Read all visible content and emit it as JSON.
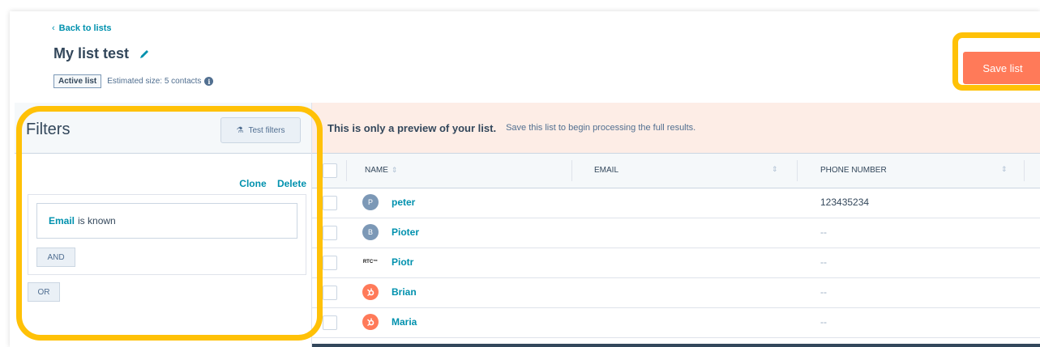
{
  "header": {
    "back_link": "Back to lists",
    "title": "My list test",
    "status_tag": "Active list",
    "estimated_size": "Estimated size: 5 contacts",
    "info_glyph": "i",
    "save_button": "Save list"
  },
  "filters": {
    "title": "Filters",
    "test_button": "Test filters",
    "clone": "Clone",
    "delete": "Delete",
    "filter_property": "Email",
    "filter_condition": "is known",
    "and_button": "AND",
    "or_button": "OR"
  },
  "preview": {
    "banner_bold": "This is only a preview of your list.",
    "banner_text": "Save this list to begin processing the full results.",
    "columns": {
      "name": "NAME",
      "email": "EMAIL",
      "phone": "PHONE NUMBER"
    },
    "rows": [
      {
        "avatar": "P",
        "avatar_type": "initial",
        "name": "peter",
        "phone": "123435234"
      },
      {
        "avatar": "B",
        "avatar_type": "initial",
        "name": "Pioter",
        "phone": "--"
      },
      {
        "avatar": "RTC™",
        "avatar_type": "logo",
        "name": "Piotr",
        "phone": "--"
      },
      {
        "avatar": "",
        "avatar_type": "hubspot-icon",
        "name": "Brian",
        "phone": "--"
      },
      {
        "avatar": "",
        "avatar_type": "hubspot-icon",
        "name": "Maria",
        "phone": "--"
      }
    ]
  },
  "colors": {
    "accent": "#0091ae",
    "save_button": "#ff7a59",
    "highlight": "#ffc107",
    "banner": "#fdede6"
  }
}
